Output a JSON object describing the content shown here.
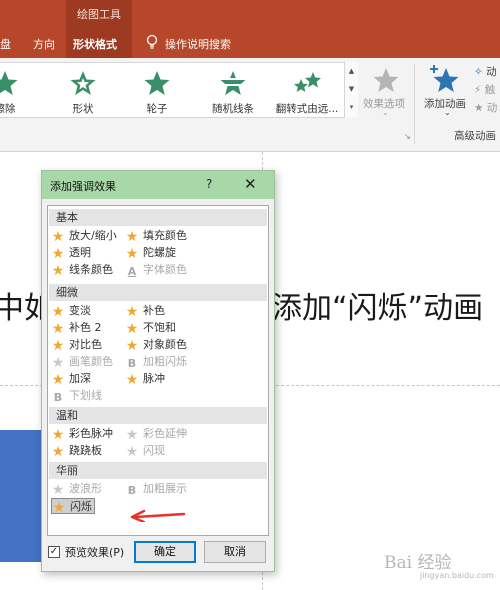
{
  "ribbon": {
    "context_title": "绘图工具",
    "tabs": [
      "盘",
      "方向",
      "形状格式",
      "操作说明搜索"
    ],
    "gallery": [
      {
        "label": "擦除",
        "icon": "star-icon"
      },
      {
        "label": "形状",
        "icon": "star-outline-icon"
      },
      {
        "label": "轮子",
        "icon": "star-icon"
      },
      {
        "label": "随机线条",
        "icon": "random-bars-star-icon"
      },
      {
        "label": "翻转式由远...",
        "icon": "multi-star-icon"
      }
    ],
    "effect_options": "效果选项",
    "add_animation": "添加动画",
    "advanced_group": "高级动画",
    "cut_right_1": "动",
    "cut_right_2": "触",
    "cut_right_3": "动"
  },
  "slide": {
    "text_left": "中如",
    "text_right": "添加“闪烁”动画"
  },
  "dialog": {
    "title": "添加强调效果",
    "help": "?",
    "close": "✕",
    "categories": [
      {
        "label": "基本",
        "effects": [
          {
            "label": "放大/缩小",
            "enabled": true
          },
          {
            "label": "填充颜色",
            "enabled": true
          },
          {
            "label": "透明",
            "enabled": true
          },
          {
            "label": "陀螺旋",
            "enabled": true
          },
          {
            "label": "线条颜色",
            "enabled": true
          },
          {
            "label": "字体颜色",
            "enabled": false
          }
        ]
      },
      {
        "label": "细微",
        "effects": [
          {
            "label": "变淡",
            "enabled": true
          },
          {
            "label": "补色",
            "enabled": true
          },
          {
            "label": "补色 2",
            "enabled": true
          },
          {
            "label": "不饱和",
            "enabled": true
          },
          {
            "label": "对比色",
            "enabled": true
          },
          {
            "label": "对象颜色",
            "enabled": true
          },
          {
            "label": "画笔颜色",
            "enabled": false
          },
          {
            "label": "加粗闪烁",
            "enabled": false
          },
          {
            "label": "加深",
            "enabled": true
          },
          {
            "label": "脉冲",
            "enabled": true
          },
          {
            "label": "下划线",
            "enabled": false
          }
        ]
      },
      {
        "label": "温和",
        "effects": [
          {
            "label": "彩色脉冲",
            "enabled": true
          },
          {
            "label": "彩色延伸",
            "enabled": false
          },
          {
            "label": "跷跷板",
            "enabled": true
          },
          {
            "label": "闪现",
            "enabled": false
          }
        ]
      },
      {
        "label": "华丽",
        "effects": [
          {
            "label": "波浪形",
            "enabled": false
          },
          {
            "label": "加粗展示",
            "enabled": false
          },
          {
            "label": "闪烁",
            "enabled": true,
            "selected": true
          }
        ]
      }
    ],
    "preview_label": "预览效果(P)",
    "preview_checked": true,
    "ok": "确定",
    "cancel": "取消"
  },
  "watermark": {
    "text": "Bai 经验",
    "sub": "jingyan.baidu.com"
  },
  "colors": {
    "ribbon": "#b7472a",
    "dialog_title": "#a8d8a8",
    "star": "#f0a830",
    "gallery_star": "#3a8f6a",
    "shape_fill": "#4472c4",
    "arrow": "#e8322a"
  }
}
